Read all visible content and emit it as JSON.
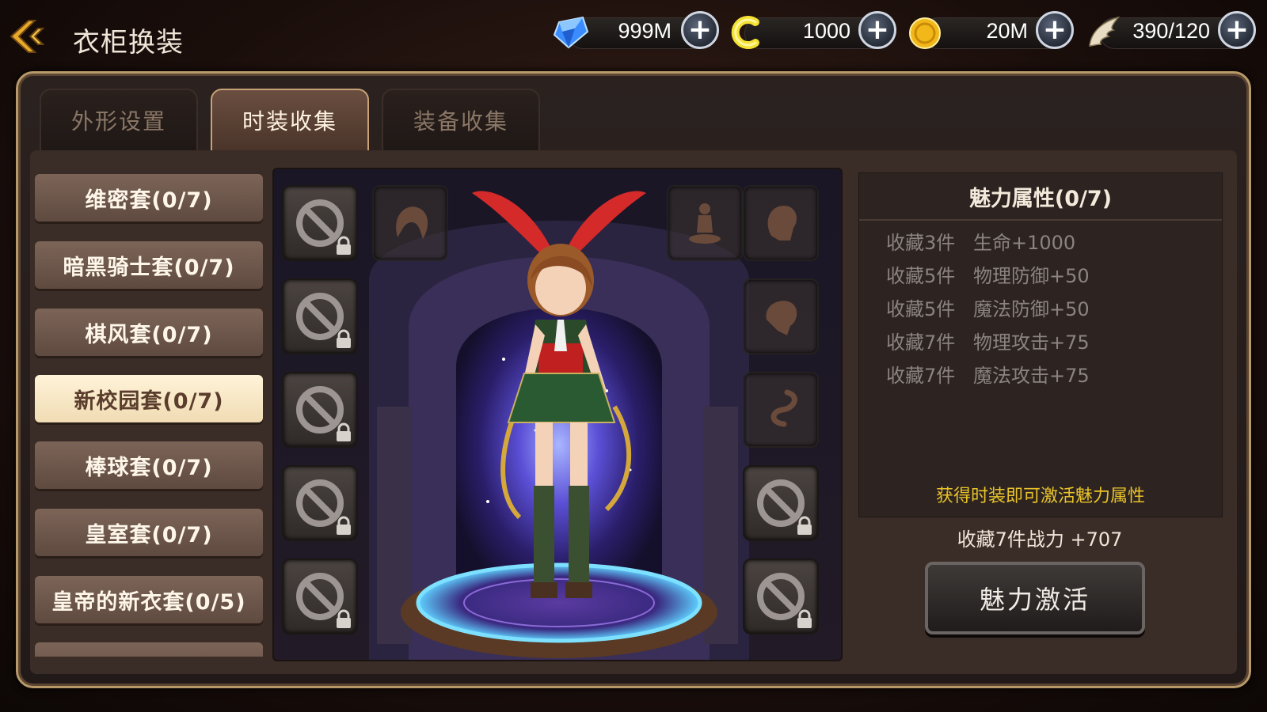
{
  "header": {
    "title": "衣柜换装",
    "resources": [
      {
        "name": "diamond",
        "icon": "blue-diamond-icon",
        "value": "999M"
      },
      {
        "name": "coupon",
        "icon": "yellow-c-coin-icon",
        "value": "1000"
      },
      {
        "name": "gold",
        "icon": "gold-coin-icon",
        "value": "20M"
      },
      {
        "name": "stamina",
        "icon": "wing-icon",
        "value": "390/120"
      }
    ]
  },
  "tabs": [
    {
      "label": "外形设置",
      "active": false
    },
    {
      "label": "时装收集",
      "active": true
    },
    {
      "label": "装备收集",
      "active": false
    }
  ],
  "sets": [
    {
      "label": "维密套(0/7)",
      "selected": false
    },
    {
      "label": "暗黑骑士套(0/7)",
      "selected": false
    },
    {
      "label": "棋风套(0/7)",
      "selected": false
    },
    {
      "label": "新校园套(0/7)",
      "selected": true
    },
    {
      "label": "棒球套(0/7)",
      "selected": false
    },
    {
      "label": "皇室套(0/7)",
      "selected": false
    },
    {
      "label": "皇帝的新衣套(0/5)",
      "selected": false
    },
    {
      "label": "",
      "selected": false
    }
  ],
  "attributes": {
    "title": "魅力属性(0/7)",
    "rows": [
      {
        "count": "收藏3件",
        "bonus": "生命+1000"
      },
      {
        "count": "收藏5件",
        "bonus": "物理防御+50"
      },
      {
        "count": "收藏5件",
        "bonus": "魔法防御+50"
      },
      {
        "count": "收藏7件",
        "bonus": "物理攻击+75"
      },
      {
        "count": "收藏7件",
        "bonus": "魔法攻击+75"
      }
    ],
    "hint": "获得时装即可激活魅力属性"
  },
  "power_text": "收藏7件战力 +707",
  "activate_button": "魅力激活",
  "colors": {
    "hint_yellow": "#e9c32a",
    "frame_gold": "#b89a6a",
    "selected_item": "#f0dcb4"
  }
}
